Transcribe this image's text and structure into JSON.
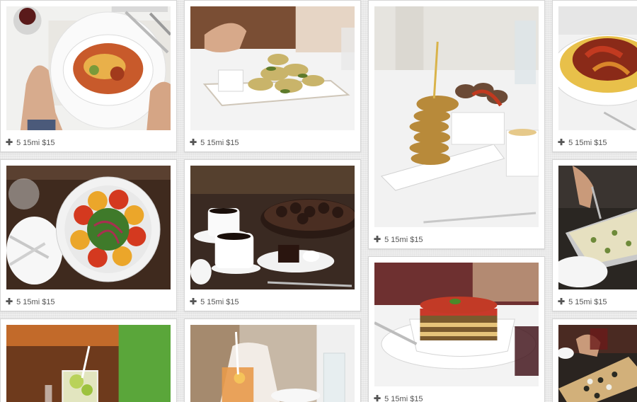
{
  "pins": [
    {
      "id": "pin-1",
      "dish": "baked pasta bowl",
      "meta_label": "5 15mi $15"
    },
    {
      "id": "pin-2",
      "dish": "fried zucchini",
      "meta_label": "5 15mi $15"
    },
    {
      "id": "pin-3",
      "dish": "eggplant stack skewer",
      "meta_label": "5 15mi $15"
    },
    {
      "id": "pin-4",
      "dish": "pasta with peppers",
      "meta_label": "5 15mi $15"
    },
    {
      "id": "pin-5",
      "dish": "tomato salad",
      "meta_label": "5 15mi $15"
    },
    {
      "id": "pin-6",
      "dish": "coffee and chocolate dessert",
      "meta_label": "5 15mi $15"
    },
    {
      "id": "pin-7",
      "dish": "lasagna",
      "meta_label": "5 15mi $15"
    },
    {
      "id": "pin-8",
      "dish": "pasta tray",
      "meta_label": "5 15mi $15"
    },
    {
      "id": "pin-9",
      "dish": "lime cocktail",
      "meta_label": ""
    },
    {
      "id": "pin-10",
      "dish": "peach iced tea",
      "meta_label": ""
    },
    {
      "id": "pin-11",
      "dish": "flatbread pizza",
      "meta_label": ""
    }
  ],
  "icons": {
    "add": "plus-icon"
  },
  "colors": {
    "background": "#e9e9e9",
    "card": "#ffffff",
    "meta_text": "#555555"
  }
}
